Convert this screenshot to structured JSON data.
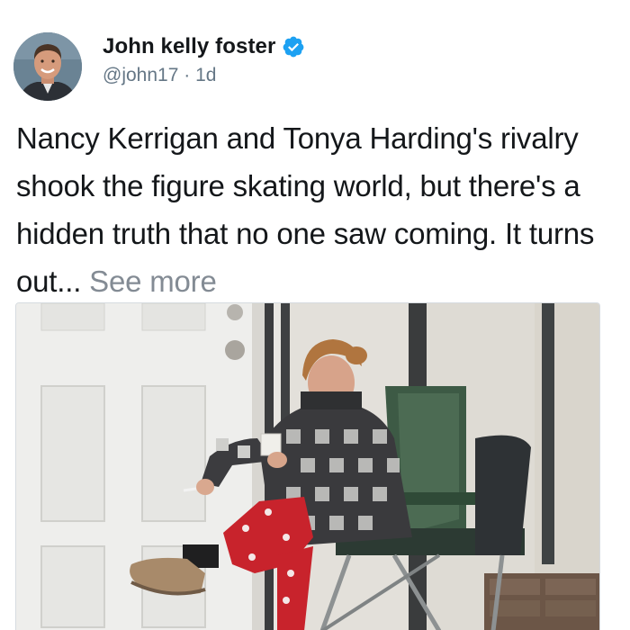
{
  "author": {
    "name": "John kelly foster",
    "handle": "@john17",
    "separator": "·",
    "time": "1d",
    "verified": true
  },
  "tweet": {
    "text": "Nancy Kerrigan and Tonya Harding's rivalry shook the figure skating world, but there's a hidden truth that no one saw coming. It turns out...",
    "see_more_label": "See more"
  },
  "colors": {
    "verified_badge": "#1da1f2",
    "see_more": "#838b94",
    "handle": "#657786"
  },
  "icons": {
    "verified": "verified-badge-icon"
  }
}
